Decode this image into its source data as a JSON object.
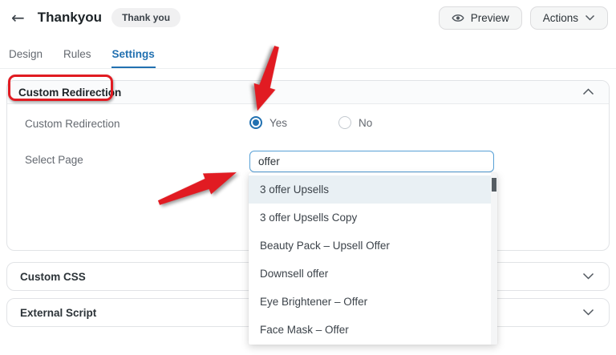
{
  "topbar": {
    "title": "Thankyou",
    "badge": "Thank you",
    "preview_label": "Preview",
    "actions_label": "Actions"
  },
  "tabs": [
    {
      "label": "Design"
    },
    {
      "label": "Rules"
    },
    {
      "label": "Settings"
    }
  ],
  "active_tab": "Settings",
  "custom_redirection_section": {
    "title": "Custom Redirection",
    "redirection_field": {
      "label": "Custom Redirection",
      "options": [
        {
          "label": "Yes",
          "selected": true
        },
        {
          "label": "No",
          "selected": false
        }
      ],
      "selected_option": "Yes"
    },
    "select_page_field": {
      "label": "Select Page",
      "value": "offer"
    },
    "dropdown_items": [
      "3 offer Upsells",
      "3 offer Upsells Copy",
      "Beauty Pack – Upsell Offer",
      "Downsell offer",
      "Eye Brightener – Offer",
      "Face Mask – Offer"
    ],
    "highlighted_item": "3 offer Upsells"
  },
  "custom_css_section": {
    "title": "Custom CSS"
  },
  "external_script_section": {
    "title": "External Script"
  },
  "colors": {
    "accent_blue": "#2271b1",
    "annotation_red": "#e11b22",
    "dropdown_highlight": "#e9f0f4"
  }
}
